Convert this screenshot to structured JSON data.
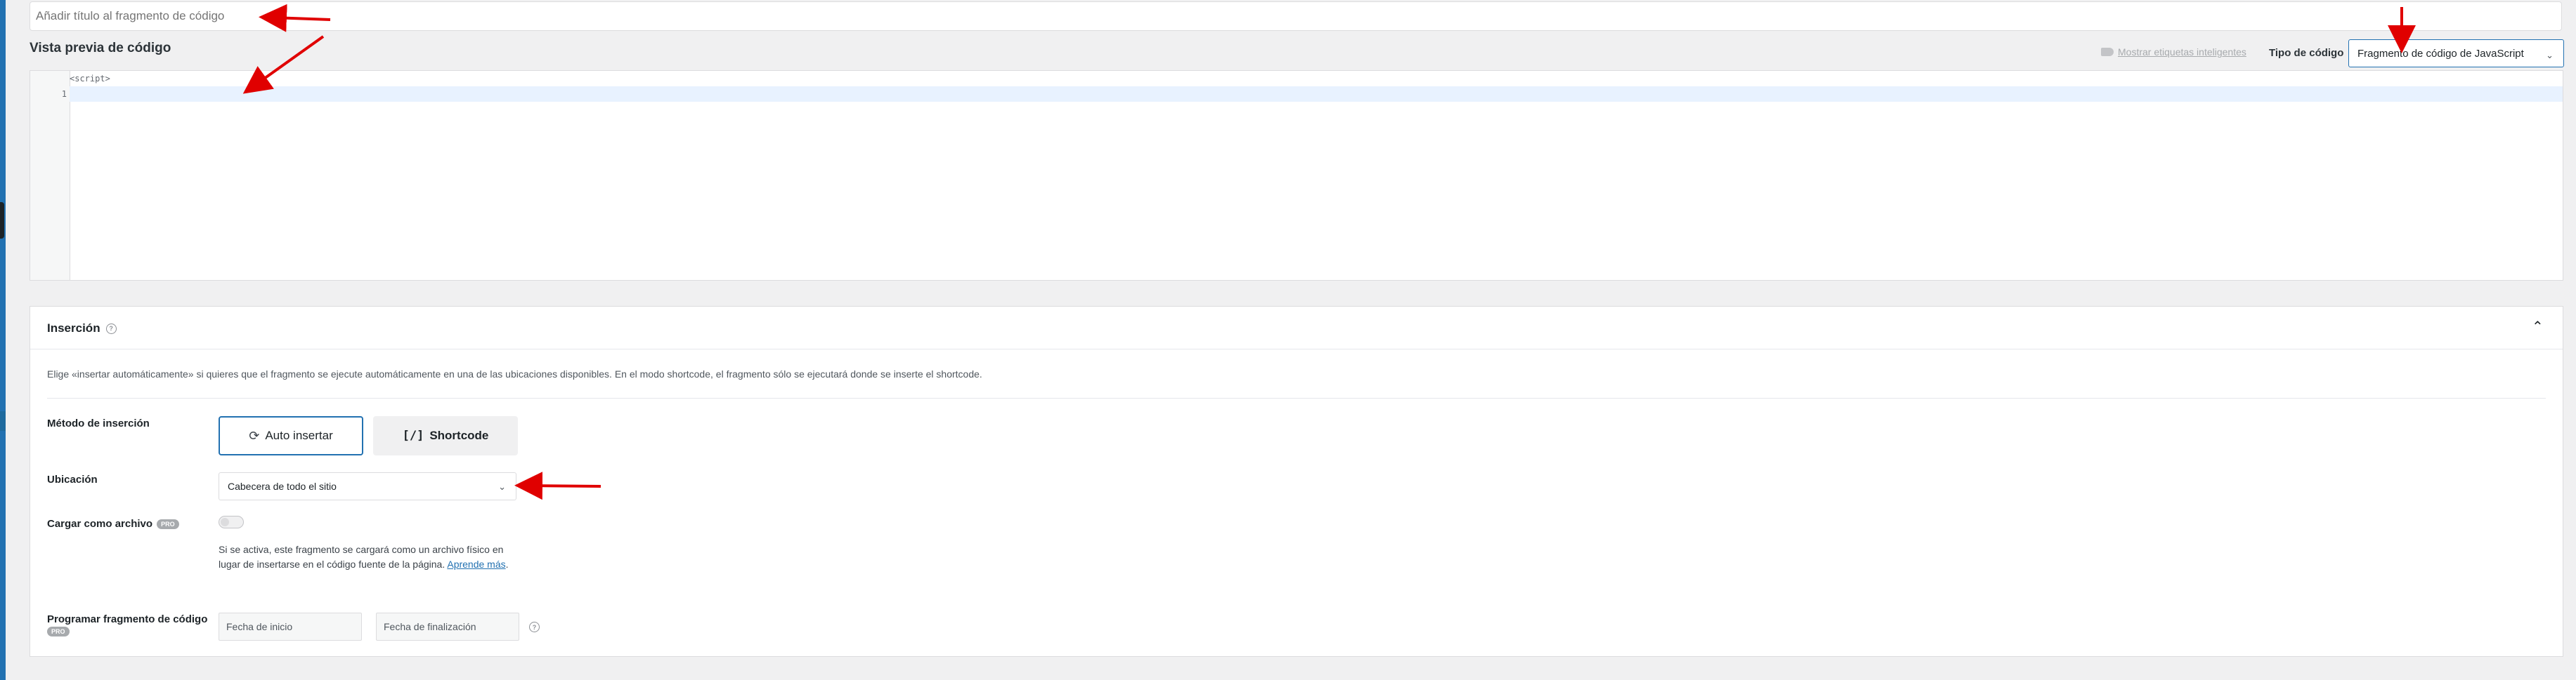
{
  "title_input": {
    "placeholder": "Añadir título al fragmento de código"
  },
  "code_preview": {
    "title": "Vista previa de código",
    "smart_tags_link": "Mostrar etiquetas inteligentes",
    "code_type_label": "Tipo de código",
    "code_type_value": "Fragmento de código de JavaScript",
    "code_prefix": "<script>",
    "line_numbers": [
      "1"
    ]
  },
  "insertion": {
    "title": "Inserción",
    "description": "Elige «insertar automáticamente» si quieres que el fragmento se ejecute automáticamente en una de las ubicaciones disponibles. En el modo shortcode, el fragmento sólo se ejecutará donde se inserte el shortcode.",
    "method_label": "Método de inserción",
    "auto_insert_label": "Auto insertar",
    "shortcode_label": "Shortcode",
    "location_label": "Ubicación",
    "location_value": "Cabecera de todo el sitio",
    "load_as_file_label": "Cargar como archivo",
    "pro_badge": "PRO",
    "load_as_file_desc": "Si se activa, este fragmento se cargará como un archivo físico en lugar de insertarse en el código fuente de la página.",
    "learn_more_link": "Aprende más",
    "schedule_label": "Programar fragmento de código",
    "start_date_placeholder": "Fecha de inicio",
    "end_date_placeholder": "Fecha de finalización"
  },
  "colors": {
    "accent": "#2271b1",
    "arrow": "#e00000"
  },
  "icons": [
    "tag-icon",
    "chevron-down-icon",
    "help-icon",
    "chevron-up-icon",
    "sync-icon",
    "shortcode-icon",
    "arrow-annotation"
  ]
}
